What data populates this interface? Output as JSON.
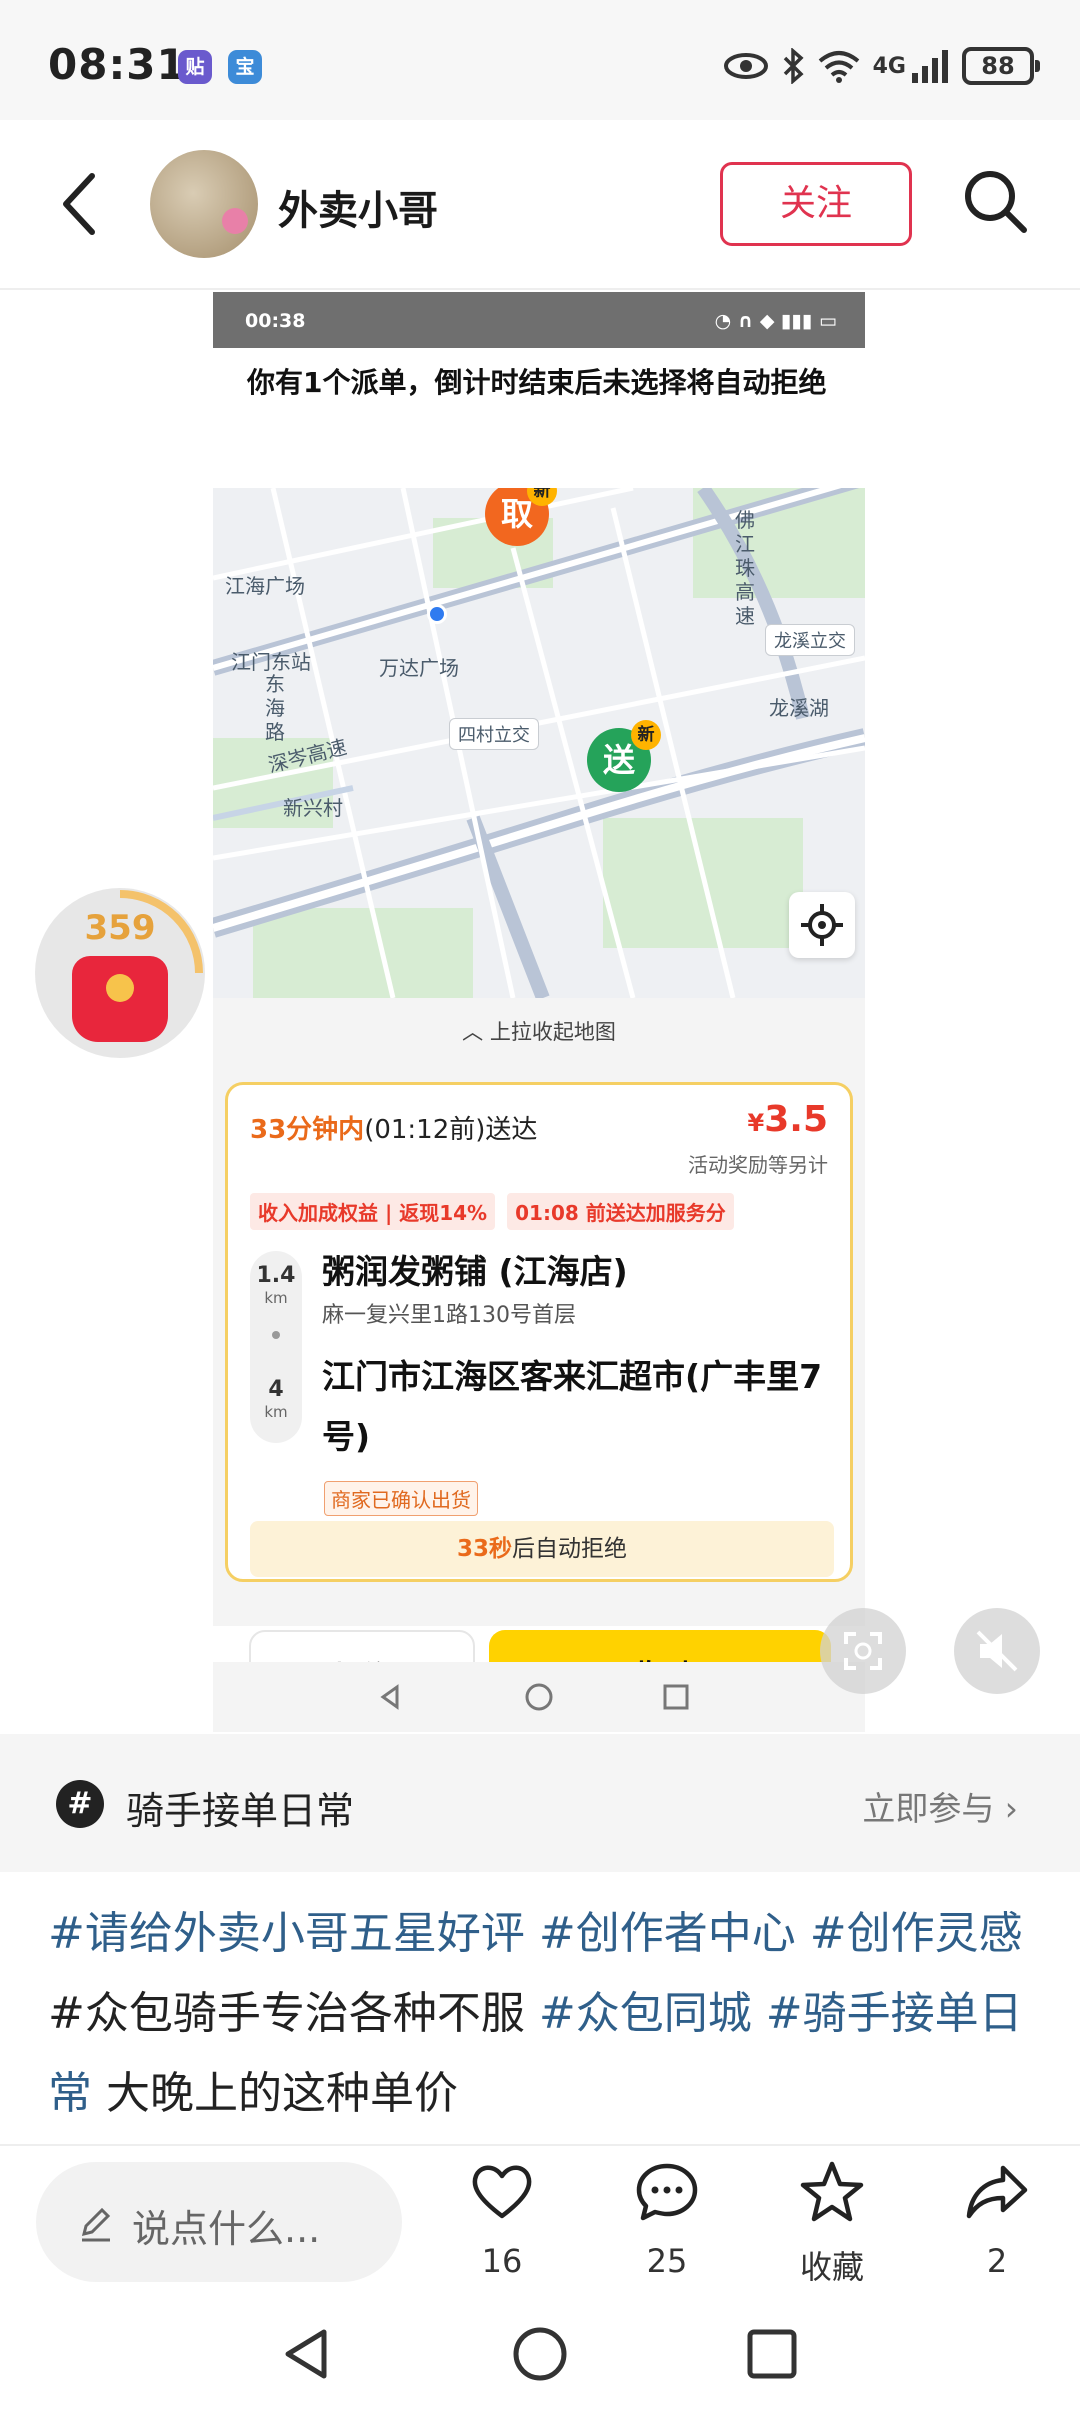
{
  "status_bar": {
    "time": "08:31",
    "app_icon_1": "贴",
    "app_icon_2": "宝",
    "network": "4G",
    "battery": "88",
    "icons": [
      "eye-icon",
      "bluetooth-icon",
      "wifi-icon",
      "signal-icon"
    ]
  },
  "header": {
    "author_name": "外卖小哥",
    "follow_label": "关注"
  },
  "screenshot": {
    "status_time": "00:38",
    "notice": "你有1个派单，倒计时结束后未选择将自动拒绝",
    "map": {
      "pickup_pin": "取",
      "delivery_pin": "送",
      "new_badge": "新",
      "labels": {
        "jianghai_plaza": "江海广场",
        "jiangmen_east": "江门东站",
        "wanda_plaza": "万达广场",
        "donghai_road": "东海路",
        "shencen_expressway": "深岑高速",
        "xinxing_village": "新兴村",
        "fojiangzhu_expressway": "佛江珠高速",
        "longxi_lake": "龙溪湖"
      },
      "tags": {
        "longxi_interchange": "龙溪立交",
        "sicun_interchange": "四村立交"
      }
    },
    "pull_map_label": "上拉收起地图",
    "order": {
      "deliver_minutes": "33分钟内",
      "deliver_deadline": "(01:12前)送达",
      "price_symbol": "¥",
      "price": "3.5",
      "bonus_note": "活动奖励等另计",
      "tags": [
        "收入加成权益 | 返现14%",
        "01:08 前送达加服务分"
      ],
      "pickup_distance": "1.4",
      "delivery_distance": "4",
      "distance_unit": "km",
      "shop_name": "粥润发粥铺 (江海店)",
      "shop_address": "麻一复兴里1路130号首层",
      "destination": "江门市江海区客来汇超市(广丰里7号)",
      "merchant_status": "商家已确认出货",
      "countdown_seconds": "33秒",
      "countdown_suffix": "后自动拒绝",
      "reject_label": "拒绝",
      "accept_label": "收到"
    }
  },
  "reward_widget": {
    "count": "359"
  },
  "topic": {
    "name": "骑手接单日常",
    "join_label": "立即参与"
  },
  "caption": {
    "segments": [
      {
        "text": "#请给外卖小哥五星好评 ",
        "type": "tag"
      },
      {
        "text": "#创作者中心 ",
        "type": "tag"
      },
      {
        "text": "#创作灵感",
        "type": "tag"
      },
      {
        "text": "#众包骑手专治各种不服 ",
        "type": "plain"
      },
      {
        "text": "#众包同城 ",
        "type": "tag"
      },
      {
        "text": "#骑手接单日常",
        "type": "tag"
      },
      {
        "text": " 大晚上的这种单价",
        "type": "plain"
      }
    ]
  },
  "action_bar": {
    "comment_placeholder": "说点什么...",
    "like_count": "16",
    "comment_count": "25",
    "favorite_label": "收藏",
    "share_count": "2"
  },
  "colors": {
    "follow_red": "#e0334f",
    "hashtag_blue": "#2f5f8a",
    "accept_yellow": "#ffd200",
    "price_red": "#e8392a"
  }
}
